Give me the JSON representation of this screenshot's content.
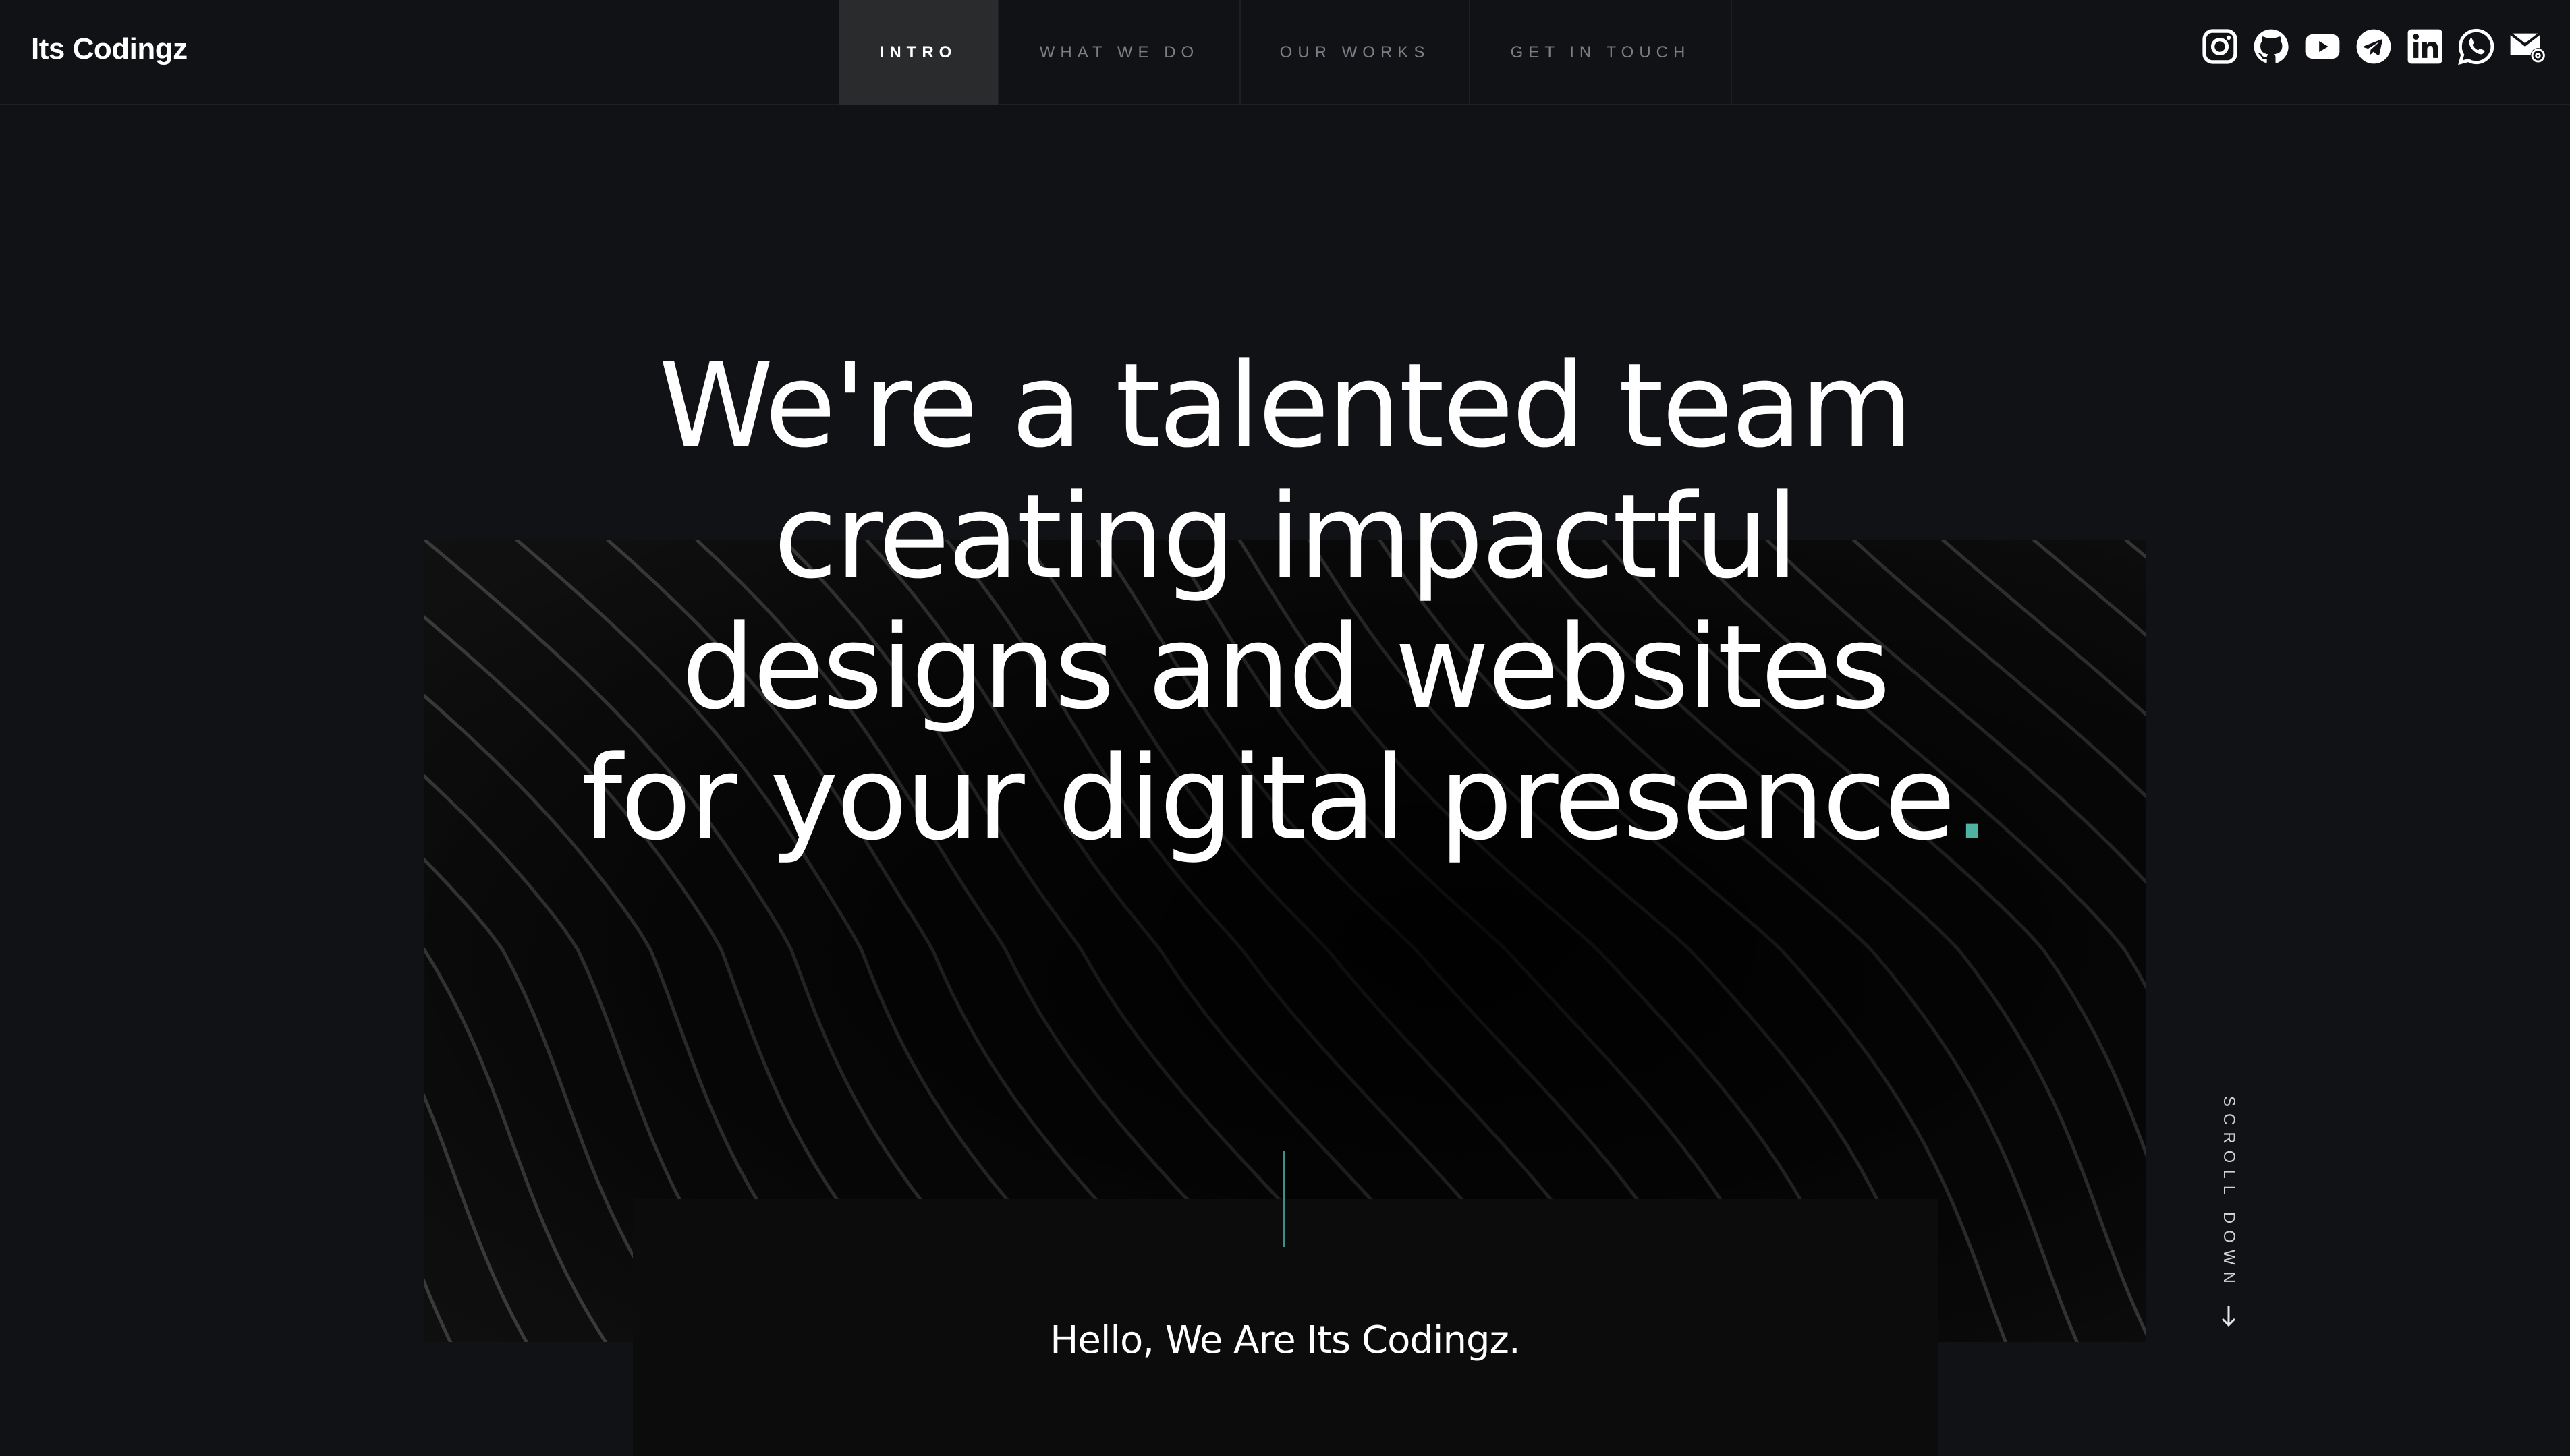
{
  "header": {
    "logo": "Its Codingz",
    "nav": [
      {
        "label": "INTRO",
        "active": true
      },
      {
        "label": "WHAT WE DO",
        "active": false
      },
      {
        "label": "OUR WORKS",
        "active": false
      },
      {
        "label": "GET IN TOUCH",
        "active": false
      }
    ],
    "social_icons": [
      "instagram-icon",
      "github-icon",
      "youtube-icon",
      "telegram-icon",
      "linkedin-icon",
      "whatsapp-icon",
      "email-icon"
    ]
  },
  "hero": {
    "headline_lines": [
      "We're a talented team",
      "creating impactful",
      "designs and websites",
      "for your digital presence"
    ],
    "headline_end": ".",
    "accent_color": "#4fb3a3"
  },
  "intro": {
    "greeting": "Hello, We Are Its Codingz."
  },
  "scroll": {
    "label": "SCROLL DOWN"
  }
}
